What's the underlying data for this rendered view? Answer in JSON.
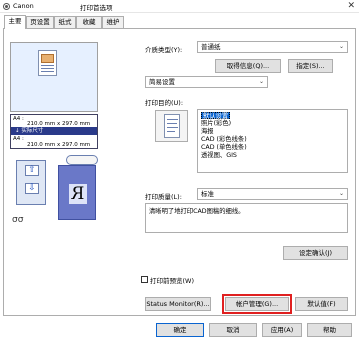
{
  "titlebar": {
    "brand": "Canon",
    "title": "打印首选项",
    "close_glyph": "✕"
  },
  "tabs": [
    "主要",
    "页设置",
    "纸式",
    "收藏",
    "维护"
  ],
  "preview": {
    "size_row1": "A4 :",
    "size_row2": "210.0 mm x 297.0 mm",
    "actual_size": "↓ 实际尺寸",
    "size_row3": "A4 :",
    "size_row4": "210.0 mm x 297.0 mm",
    "arrow_up": "⇧",
    "arrow_down": "⇩",
    "mirror_letter": "R",
    "feed_glyph": "σσ"
  },
  "media_type": {
    "label": "介质类型(Y):",
    "value": "普通纸"
  },
  "buttons": {
    "get_info": "取得信息(Q)...",
    "specify": "指定(S)...",
    "confirm_settings": "设定确认(J)",
    "status_monitor": "Status Monitor(R)...",
    "account_management": "帐户管理(G)...",
    "defaults": "默认值(F)",
    "ok": "确定",
    "cancel": "取消",
    "apply": "应用(A)",
    "help": "帮助"
  },
  "settings_mode": {
    "value": "简易设置"
  },
  "print_purpose": {
    "label": "打印目的(U):",
    "items": [
      "默认设置",
      "照片(彩色)",
      "海报",
      "CAD (彩色线条)",
      "CAD (单色线条)",
      "透视图、GIS"
    ],
    "selected_index": 0
  },
  "print_quality": {
    "label": "打印质量(L):",
    "value": "标准"
  },
  "description": "清晰明了地打印CAD图稿的细线。",
  "print_preview": {
    "label": "打印前预览(W)",
    "checked": false
  }
}
